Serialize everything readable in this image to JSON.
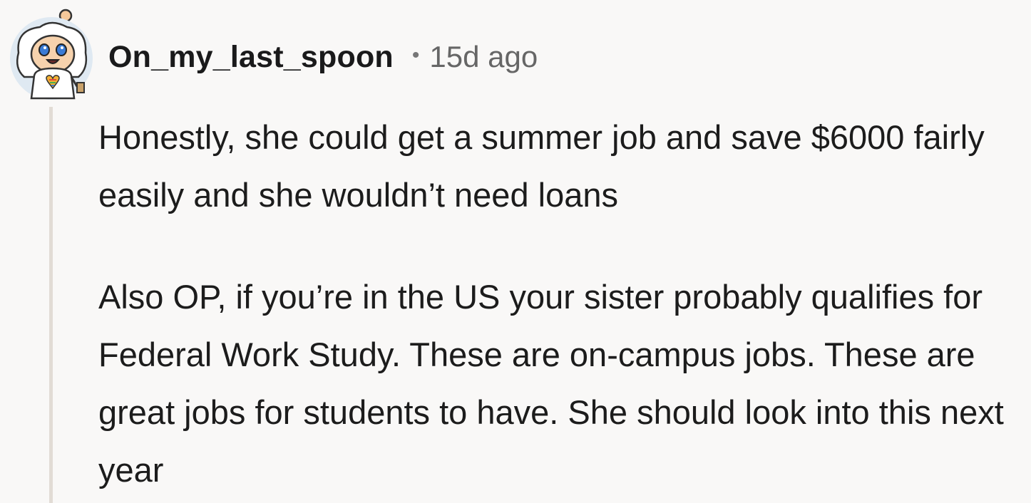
{
  "comment": {
    "username": "On_my_last_spoon",
    "separator": "•",
    "time_ago": "15d ago",
    "avatar_icon": "snoo-avatar-icon",
    "paragraphs": [
      "Honestly, she could get a summer job and save $6000 fairly easily and she wouldn’t need loans",
      "Also OP, if you’re in the US your sister probably qualifies for Federal Work Study. These are on-campus jobs. These are great jobs for students to have. She should look into this next year"
    ]
  }
}
